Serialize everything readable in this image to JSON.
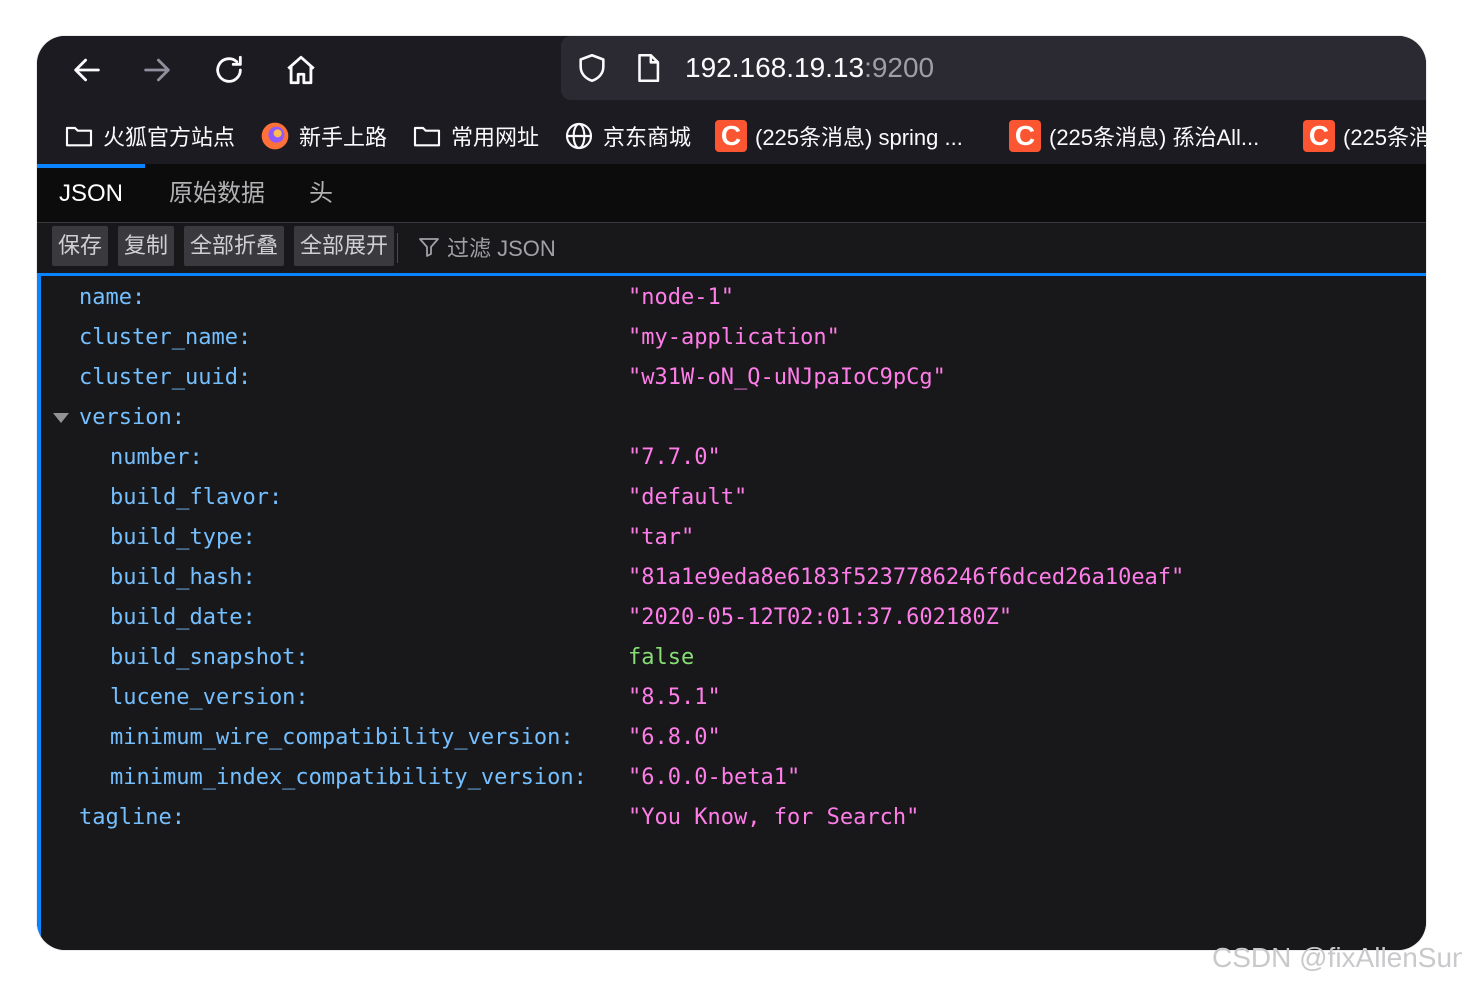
{
  "url": {
    "host": "192.168.19.13",
    "port": ":9200"
  },
  "bookmarks": [
    {
      "icon": "folder-icon",
      "label": "火狐官方站点"
    },
    {
      "icon": "firefox-icon",
      "label": "新手上路"
    },
    {
      "icon": "folder-icon",
      "label": "常用网址"
    },
    {
      "icon": "globe-icon",
      "label": "京东商城"
    },
    {
      "icon": "csdn-icon",
      "label": "(225条消息) spring ..."
    },
    {
      "icon": "csdn-icon",
      "label": "(225条消息) 孫治All..."
    },
    {
      "icon": "csdn-icon",
      "label": "(225条消"
    }
  ],
  "csdn_logo_letter": "C",
  "tabs": [
    "JSON",
    "原始数据",
    "头"
  ],
  "actions": {
    "save": "保存",
    "copy": "复制",
    "collapse_all": "全部折叠",
    "expand_all": "全部展开",
    "filter_placeholder": "过滤 JSON"
  },
  "json_tree": [
    {
      "key": "name:",
      "value": "\"node-1\"",
      "type": "string",
      "depth": 0
    },
    {
      "key": "cluster_name:",
      "value": "\"my-application\"",
      "type": "string",
      "depth": 0
    },
    {
      "key": "cluster_uuid:",
      "value": "\"w31W-oN_Q-uNJpaIoC9pCg\"",
      "type": "string",
      "depth": 0
    },
    {
      "key": "version:",
      "value": "",
      "type": "object",
      "depth": 0,
      "expanded": true
    },
    {
      "key": "number:",
      "value": "\"7.7.0\"",
      "type": "string",
      "depth": 1
    },
    {
      "key": "build_flavor:",
      "value": "\"default\"",
      "type": "string",
      "depth": 1
    },
    {
      "key": "build_type:",
      "value": "\"tar\"",
      "type": "string",
      "depth": 1
    },
    {
      "key": "build_hash:",
      "value": "\"81a1e9eda8e6183f5237786246f6dced26a10eaf\"",
      "type": "string",
      "depth": 1
    },
    {
      "key": "build_date:",
      "value": "\"2020-05-12T02:01:37.602180Z\"",
      "type": "string",
      "depth": 1
    },
    {
      "key": "build_snapshot:",
      "value": "false",
      "type": "boolean",
      "depth": 1
    },
    {
      "key": "lucene_version:",
      "value": "\"8.5.1\"",
      "type": "string",
      "depth": 1
    },
    {
      "key": "minimum_wire_compatibility_version:",
      "value": "\"6.8.0\"",
      "type": "string",
      "depth": 1
    },
    {
      "key": "minimum_index_compatibility_version:",
      "value": "\"6.0.0-beta1\"",
      "type": "string",
      "depth": 1
    },
    {
      "key": "tagline:",
      "value": "\"You Know, for Search\"",
      "type": "string",
      "depth": 0
    }
  ],
  "watermark": "CSDN @fixAllenSun",
  "colors": {
    "accent": "#0a84ff",
    "key": "#75bfff",
    "string": "#ff7de9",
    "boolean": "#86de74"
  }
}
